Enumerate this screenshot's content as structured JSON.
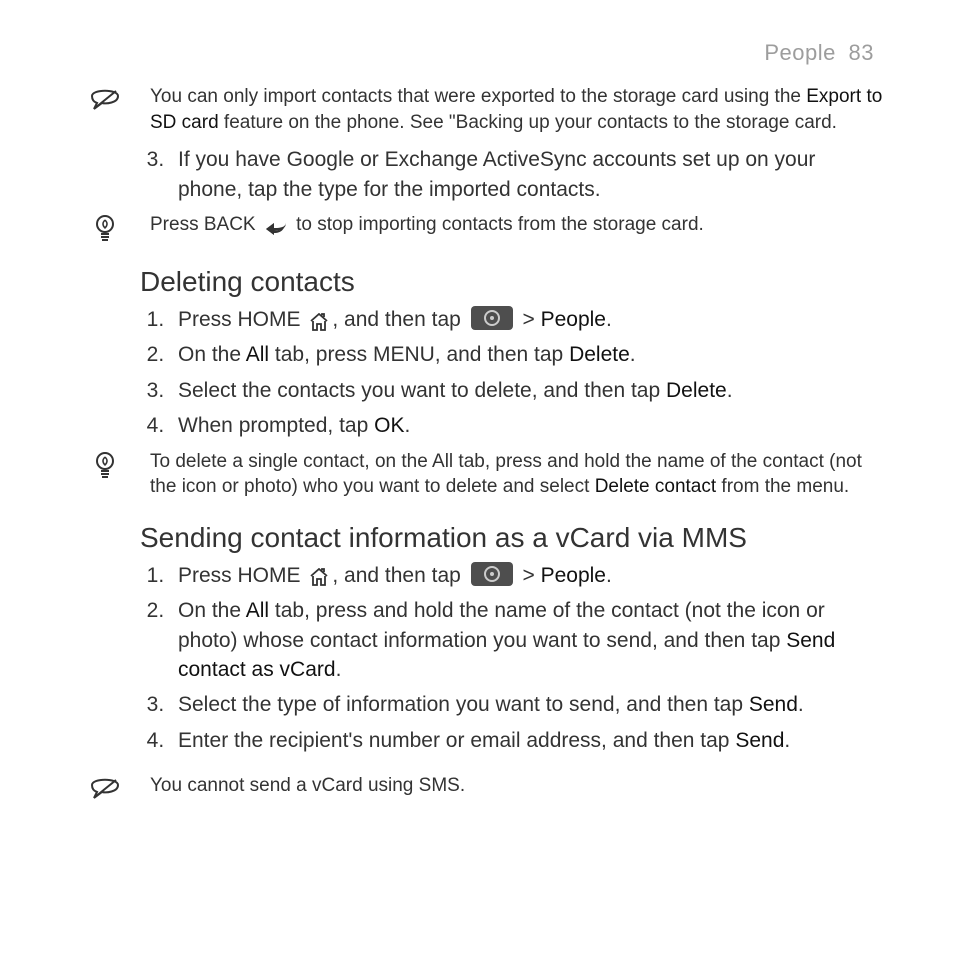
{
  "header": {
    "section": "People",
    "page": "83"
  },
  "note1": {
    "pre": "You can only import contacts that were exported to the storage card using the ",
    "bold": "Export to SD card",
    "post": " feature on the phone. See \"Backing up your contacts to the storage card."
  },
  "import_step3": "If you have Google or Exchange ActiveSync accounts set up on your phone, tap the type for the imported contacts.",
  "tip1": {
    "pre": "Press BACK ",
    "post": " to stop importing contacts from the storage card."
  },
  "deleting": {
    "title": "Deleting contacts",
    "step1": {
      "pre": "Press HOME ",
      "mid": ", and then tap ",
      "post1": " > ",
      "people": "People",
      "post2": "."
    },
    "step2": {
      "a": "On the ",
      "all": "All",
      "b": " tab, press MENU, and then tap ",
      "delete": "Delete",
      "c": "."
    },
    "step3": {
      "a": "Select the contacts you want to delete, and then tap ",
      "delete": "Delete",
      "b": "."
    },
    "step4": {
      "a": "When prompted, tap ",
      "ok": "OK",
      "b": "."
    },
    "tip": {
      "a": "To delete a single contact, on the All tab, press and hold the name of the contact (not the icon or photo) who you want to delete and select ",
      "bold": "Delete contact",
      "b": " from the menu."
    }
  },
  "sending": {
    "title": "Sending contact information as a vCard via MMS",
    "step1": {
      "pre": "Press HOME ",
      "mid": ", and then tap ",
      "post1": " > ",
      "people": "People",
      "post2": "."
    },
    "step2": {
      "a": "On the ",
      "all": "All",
      "b": " tab, press and hold the name of the contact (not the icon or photo) whose contact information you want to send, and then tap ",
      "bold": "Send contact as vCard",
      "c": "."
    },
    "step3": {
      "a": "Select the type of information you want to send, and then tap ",
      "send": "Send",
      "b": "."
    },
    "step4": {
      "a": "Enter the recipient's number or email address, and then tap ",
      "send": "Send",
      "b": "."
    }
  },
  "note2": "You cannot send a vCard using SMS."
}
